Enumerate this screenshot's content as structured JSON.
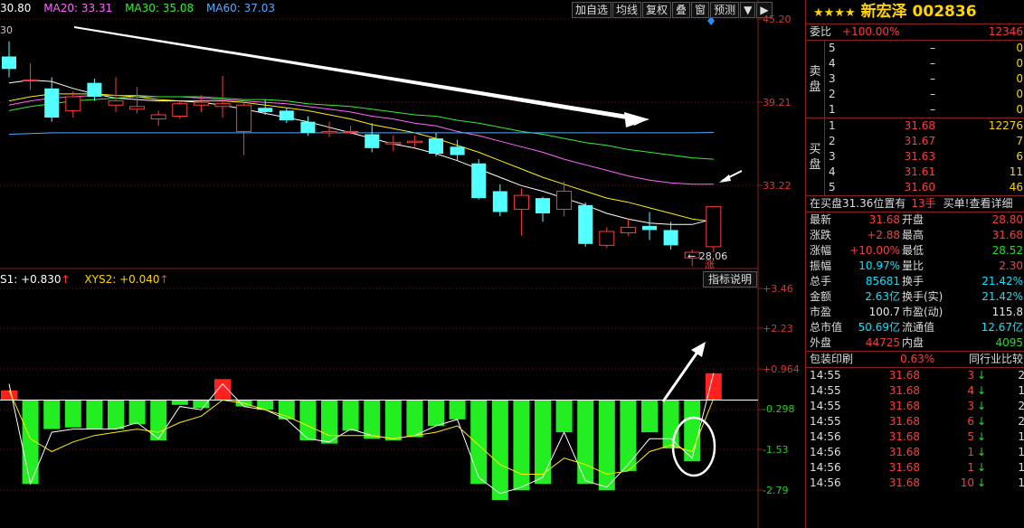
{
  "ma_legend": [
    {
      "label": "30.80",
      "color": "#ffffff"
    },
    {
      "label": "MA20: 33.31",
      "color": "#ff66ff"
    },
    {
      "label": "MA30: 35.08",
      "color": "#33ee33"
    },
    {
      "label": "MA60: 37.03",
      "color": "#55aaff"
    }
  ],
  "toolbar": [
    "加自选",
    "均线",
    "复权",
    "叠",
    "窗",
    "预测",
    "▼",
    "▶"
  ],
  "price_axis": [
    "45.20",
    "39.21",
    "33.22"
  ],
  "price_axis_left": "30",
  "low_label": "← 28.06",
  "up_marker": "涨",
  "indicator_legend": [
    {
      "label": "S1: +0.830",
      "color": "#ffffff",
      "arrow": "↑"
    },
    {
      "label": "XYS2: +0.040",
      "color": "#ffd400",
      "arrow": "↑"
    }
  ],
  "indicator_button": "指标说明",
  "ind_axis": [
    "+3.46",
    "+2.23",
    "+0.964",
    "-0.298",
    "-1.53",
    "-2.79"
  ],
  "chart_data": {
    "type": "candlestick",
    "price_ticks": [
      45.2,
      39.21,
      33.22
    ],
    "indicator_ticks": [
      3.46,
      2.23,
      0.964,
      -0.298,
      -1.53,
      -2.79
    ],
    "candles": [
      {
        "o": 42.5,
        "h": 43.6,
        "l": 41.0,
        "c": 41.6
      },
      {
        "o": 40.8,
        "h": 42.0,
        "l": 40.1,
        "c": 40.8
      },
      {
        "o": 40.2,
        "h": 41.0,
        "l": 37.8,
        "c": 38.1
      },
      {
        "o": 38.6,
        "h": 40.0,
        "l": 38.1,
        "c": 39.6
      },
      {
        "o": 40.6,
        "h": 40.9,
        "l": 39.3,
        "c": 39.6
      },
      {
        "o": 39.0,
        "h": 41.0,
        "l": 38.5,
        "c": 39.3
      },
      {
        "o": 38.7,
        "h": 40.3,
        "l": 38.4,
        "c": 38.9
      },
      {
        "o": 38.0,
        "h": 38.6,
        "l": 37.5,
        "c": 38.3
      },
      {
        "o": 38.2,
        "h": 39.3,
        "l": 38.0,
        "c": 39.1
      },
      {
        "o": 39.0,
        "h": 39.7,
        "l": 38.5,
        "c": 39.2
      },
      {
        "o": 38.9,
        "h": 41.1,
        "l": 38.1,
        "c": 39.1
      },
      {
        "o": 37.1,
        "h": 39.2,
        "l": 35.4,
        "c": 39.0
      },
      {
        "o": 38.8,
        "h": 39.4,
        "l": 38.3,
        "c": 38.5
      },
      {
        "o": 38.6,
        "h": 38.8,
        "l": 37.7,
        "c": 37.9
      },
      {
        "o": 37.8,
        "h": 38.2,
        "l": 36.8,
        "c": 37.0
      },
      {
        "o": 37.0,
        "h": 37.8,
        "l": 36.7,
        "c": 37.1
      },
      {
        "o": 37.1,
        "h": 37.5,
        "l": 36.9,
        "c": 37.1
      },
      {
        "o": 36.9,
        "h": 37.7,
        "l": 35.6,
        "c": 35.9
      },
      {
        "o": 36.2,
        "h": 36.8,
        "l": 35.7,
        "c": 36.3
      },
      {
        "o": 36.3,
        "h": 36.8,
        "l": 36.0,
        "c": 36.4
      },
      {
        "o": 36.6,
        "h": 37.0,
        "l": 35.3,
        "c": 35.5
      },
      {
        "o": 36.0,
        "h": 36.5,
        "l": 35.0,
        "c": 35.4
      },
      {
        "o": 34.8,
        "h": 35.1,
        "l": 32.2,
        "c": 32.3
      },
      {
        "o": 32.8,
        "h": 33.3,
        "l": 31.0,
        "c": 31.3
      },
      {
        "o": 31.5,
        "h": 33.0,
        "l": 29.6,
        "c": 32.5
      },
      {
        "o": 32.3,
        "h": 32.4,
        "l": 30.6,
        "c": 31.2
      },
      {
        "o": 31.5,
        "h": 33.5,
        "l": 31.0,
        "c": 32.8
      },
      {
        "o": 31.8,
        "h": 32.0,
        "l": 28.8,
        "c": 29.0
      },
      {
        "o": 28.9,
        "h": 30.2,
        "l": 28.7,
        "c": 29.9
      },
      {
        "o": 29.8,
        "h": 30.8,
        "l": 29.6,
        "c": 30.2
      },
      {
        "o": 30.3,
        "h": 31.3,
        "l": 29.3,
        "c": 30.0
      },
      {
        "o": 30.0,
        "h": 30.6,
        "l": 28.6,
        "c": 28.9
      },
      {
        "o": 28.0,
        "h": 28.6,
        "l": 27.4,
        "c": 28.4
      },
      {
        "o": 28.8,
        "h": 31.7,
        "l": 28.4,
        "c": 31.68
      }
    ],
    "ma_lines": [
      {
        "name": "30.80",
        "color": "#ffffff",
        "values": [
          40.6,
          40.8,
          40.7,
          40.2,
          39.8,
          39.5,
          39.4,
          39.3,
          39.3,
          39.2,
          39.0,
          38.7,
          38.4,
          38.1,
          37.8,
          37.4,
          37.0,
          36.6,
          36.2,
          35.9,
          35.5,
          35.0,
          34.4,
          33.8,
          33.2,
          32.8,
          32.3,
          31.8,
          31.2,
          30.8,
          30.5,
          30.4,
          30.4,
          30.8
        ]
      },
      {
        "name": "yellow",
        "color": "#ffee00",
        "values": [
          39.3,
          39.6,
          39.8,
          39.8,
          39.8,
          39.7,
          39.6,
          39.4,
          39.3,
          39.3,
          39.3,
          39.2,
          39.0,
          38.8,
          38.6,
          38.3,
          38.0,
          37.6,
          37.3,
          37.0,
          36.6,
          36.1,
          35.6,
          35.0,
          34.4,
          33.8,
          33.3,
          32.8,
          32.3,
          32.0,
          31.6,
          31.2,
          30.8,
          30.6
        ]
      },
      {
        "name": "MA20",
        "color": "#ff66ff",
        "values": [
          39.0,
          39.3,
          39.5,
          39.6,
          39.7,
          39.7,
          39.7,
          39.6,
          39.6,
          39.5,
          39.4,
          39.3,
          39.2,
          39.1,
          38.9,
          38.7,
          38.5,
          38.2,
          38.0,
          37.7,
          37.5,
          37.1,
          36.8,
          36.4,
          36.0,
          35.6,
          35.1,
          34.7,
          34.3,
          33.9,
          33.6,
          33.4,
          33.3,
          33.3
        ]
      },
      {
        "name": "MA30",
        "color": "#33ee33",
        "values": [
          38.6,
          38.9,
          39.1,
          39.3,
          39.4,
          39.5,
          39.6,
          39.6,
          39.6,
          39.6,
          39.5,
          39.4,
          39.4,
          39.3,
          39.1,
          39.0,
          38.9,
          38.7,
          38.5,
          38.3,
          38.2,
          37.9,
          37.7,
          37.4,
          37.1,
          36.9,
          36.6,
          36.3,
          36.1,
          35.8,
          35.6,
          35.4,
          35.2,
          35.1
        ]
      },
      {
        "name": "MA60",
        "color": "#55aaff",
        "values": [
          36.9,
          36.95,
          37.0,
          37.0,
          37.0,
          37.0,
          37.0,
          37.0,
          37.0,
          37.0,
          37.0,
          37.0,
          37.0,
          37.0,
          37.0,
          37.0,
          37.0,
          37.0,
          37.0,
          37.0,
          37.0,
          37.0,
          37.0,
          37.0,
          37.0,
          37.0,
          37.0,
          37.0,
          37.0,
          37.0,
          37.0,
          37.0,
          37.0,
          37.03
        ]
      }
    ],
    "histogram": [
      0.3,
      -2.6,
      -0.9,
      -0.85,
      -0.9,
      -0.9,
      -0.75,
      -1.25,
      -0.15,
      -0.25,
      0.65,
      -0.2,
      -0.3,
      -0.6,
      -1.25,
      -1.35,
      -0.95,
      -1.2,
      -1.25,
      -1.15,
      -0.8,
      -0.6,
      -2.6,
      -3.1,
      -2.8,
      -2.6,
      -1.0,
      -2.6,
      -2.8,
      -2.2,
      -1.0,
      -1.5,
      -1.9,
      0.83
    ],
    "line_s1": [
      0.5,
      -2.6,
      -1.0,
      -0.9,
      -0.9,
      -0.9,
      -0.7,
      -1.2,
      -0.2,
      -0.3,
      0.5,
      -0.2,
      -0.3,
      -0.6,
      -1.2,
      -1.3,
      -0.9,
      -1.1,
      -1.2,
      -1.1,
      -0.8,
      -0.6,
      -2.4,
      -2.9,
      -2.7,
      -2.4,
      -1.0,
      -2.5,
      -2.7,
      -2.0,
      -1.2,
      -1.2,
      -1.8,
      0.83
    ],
    "line_xys2": [
      0.3,
      -1.2,
      -1.6,
      -1.3,
      -1.1,
      -1.0,
      -0.9,
      -1.0,
      -0.7,
      -0.5,
      0.0,
      -0.1,
      -0.3,
      -0.5,
      -0.8,
      -1.1,
      -1.1,
      -1.1,
      -1.2,
      -1.1,
      -1.0,
      -0.8,
      -1.4,
      -2.0,
      -2.3,
      -2.3,
      -1.8,
      -2.0,
      -2.3,
      -2.2,
      -1.6,
      -1.4,
      -1.6,
      0.04
    ]
  },
  "panel": {
    "stars": "★★★★",
    "name": "新宏泽",
    "code": "002836",
    "weibi": {
      "label": "委比",
      "value": "+100.00%",
      "qty": "12346"
    },
    "sell_label": [
      "卖",
      "盘"
    ],
    "buy_label": [
      "买",
      "盘"
    ],
    "sell": [
      {
        "lv": "5",
        "price": "–",
        "qty": "0"
      },
      {
        "lv": "4",
        "price": "–",
        "qty": "0"
      },
      {
        "lv": "3",
        "price": "–",
        "qty": "0"
      },
      {
        "lv": "2",
        "price": "–",
        "qty": "0"
      },
      {
        "lv": "1",
        "price": "–",
        "qty": "0"
      }
    ],
    "buy": [
      {
        "lv": "1",
        "price": "31.68",
        "qty": "12276"
      },
      {
        "lv": "2",
        "price": "31.67",
        "qty": "7"
      },
      {
        "lv": "3",
        "price": "31.63",
        "qty": "6"
      },
      {
        "lv": "4",
        "price": "31.61",
        "qty": "11"
      },
      {
        "lv": "5",
        "price": "31.60",
        "qty": "46"
      }
    ],
    "position": {
      "text": "在买盘31.36位置有",
      "qty": "13手",
      "link": "买单!查看详细"
    },
    "quotes": [
      {
        "l1": "最新",
        "v1": "31.68",
        "l2": "开盘",
        "v2": "28.80",
        "c1": "red",
        "c2": "red"
      },
      {
        "l1": "涨跌",
        "v1": "+2.88",
        "l2": "最高",
        "v2": "31.68",
        "c1": "red",
        "c2": "red"
      },
      {
        "l1": "涨幅",
        "v1": "+10.00%",
        "l2": "最低",
        "v2": "28.52",
        "c1": "red",
        "c2": "green"
      },
      {
        "l1": "振幅",
        "v1": "10.97%",
        "l2": "量比",
        "v2": "2.30",
        "c1": "cyan",
        "c2": "red"
      },
      {
        "l1": "总手",
        "v1": "85681",
        "l2": "换手",
        "v2": "21.42%",
        "c1": "cyan",
        "c2": "cyan"
      },
      {
        "l1": "金额",
        "v1": "2.63亿",
        "l2": "换手(实)",
        "v2": "21.42%",
        "c1": "cyan",
        "c2": "cyan"
      },
      {
        "l1": "市盈",
        "v1": "100.7",
        "l2": "市盈(动)",
        "v2": "115.8",
        "c1": "white",
        "c2": "white"
      },
      {
        "l1": "总市值",
        "v1": "50.69亿",
        "l2": "流通值",
        "v2": "12.67亿",
        "c1": "cyan",
        "c2": "cyan"
      },
      {
        "l1": "外盘",
        "v1": "44725",
        "l2": "内盘",
        "v2": "4095",
        "c1": "red",
        "c2": "green"
      }
    ],
    "tabs": {
      "left": "包装印刷",
      "pct": "0.63%",
      "right": "同行业比较"
    },
    "ticks": [
      {
        "t": "14:55",
        "p": "31.68",
        "v": "3",
        "r": "2"
      },
      {
        "t": "14:55",
        "p": "31.68",
        "v": "4",
        "r": "1"
      },
      {
        "t": "14:55",
        "p": "31.68",
        "v": "3",
        "r": "2"
      },
      {
        "t": "14:55",
        "p": "31.68",
        "v": "6",
        "r": "2"
      },
      {
        "t": "14:56",
        "p": "31.68",
        "v": "5",
        "r": "1"
      },
      {
        "t": "14:56",
        "p": "31.68",
        "v": "1",
        "r": "1"
      },
      {
        "t": "14:56",
        "p": "31.68",
        "v": "1",
        "r": "1"
      },
      {
        "t": "14:56",
        "p": "31.68",
        "v": "10",
        "r": "1"
      }
    ]
  }
}
